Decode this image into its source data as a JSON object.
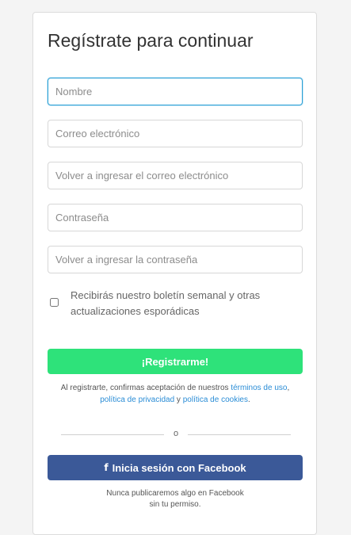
{
  "form": {
    "title": "Regístrate para continuar",
    "fields": [
      {
        "placeholder": "Nombre",
        "value": ""
      },
      {
        "placeholder": "Correo electrónico",
        "value": ""
      },
      {
        "placeholder": "Volver a ingresar el correo electrónico",
        "value": ""
      },
      {
        "placeholder": "Contraseña",
        "value": ""
      },
      {
        "placeholder": "Volver a ingresar la contraseña",
        "value": ""
      }
    ],
    "newsletter": {
      "label": "Recibirás nuestro boletín semanal y otras actualizaciones esporádicas",
      "checked": false
    },
    "register_label": "¡Registrarme!",
    "terms": {
      "prefix": "Al registrarte, confirmas aceptación de nuestros ",
      "terms_link": "términos de uso",
      "comma": ",",
      "privacy_link": "política de privacidad",
      "and": " y ",
      "cookies_link": "política de cookies",
      "period": "."
    },
    "divider_label": "o",
    "facebook": {
      "icon": "facebook-f-icon",
      "label": "Inicia sesión con Facebook",
      "note_line1": "Nunca publicaremos algo en Facebook",
      "note_line2": "sin tu permiso."
    }
  },
  "colors": {
    "register_button": "#2ee27a",
    "facebook_button": "#3b5998",
    "link": "#2b8dd6",
    "focus_border": "#2aa0d6"
  }
}
